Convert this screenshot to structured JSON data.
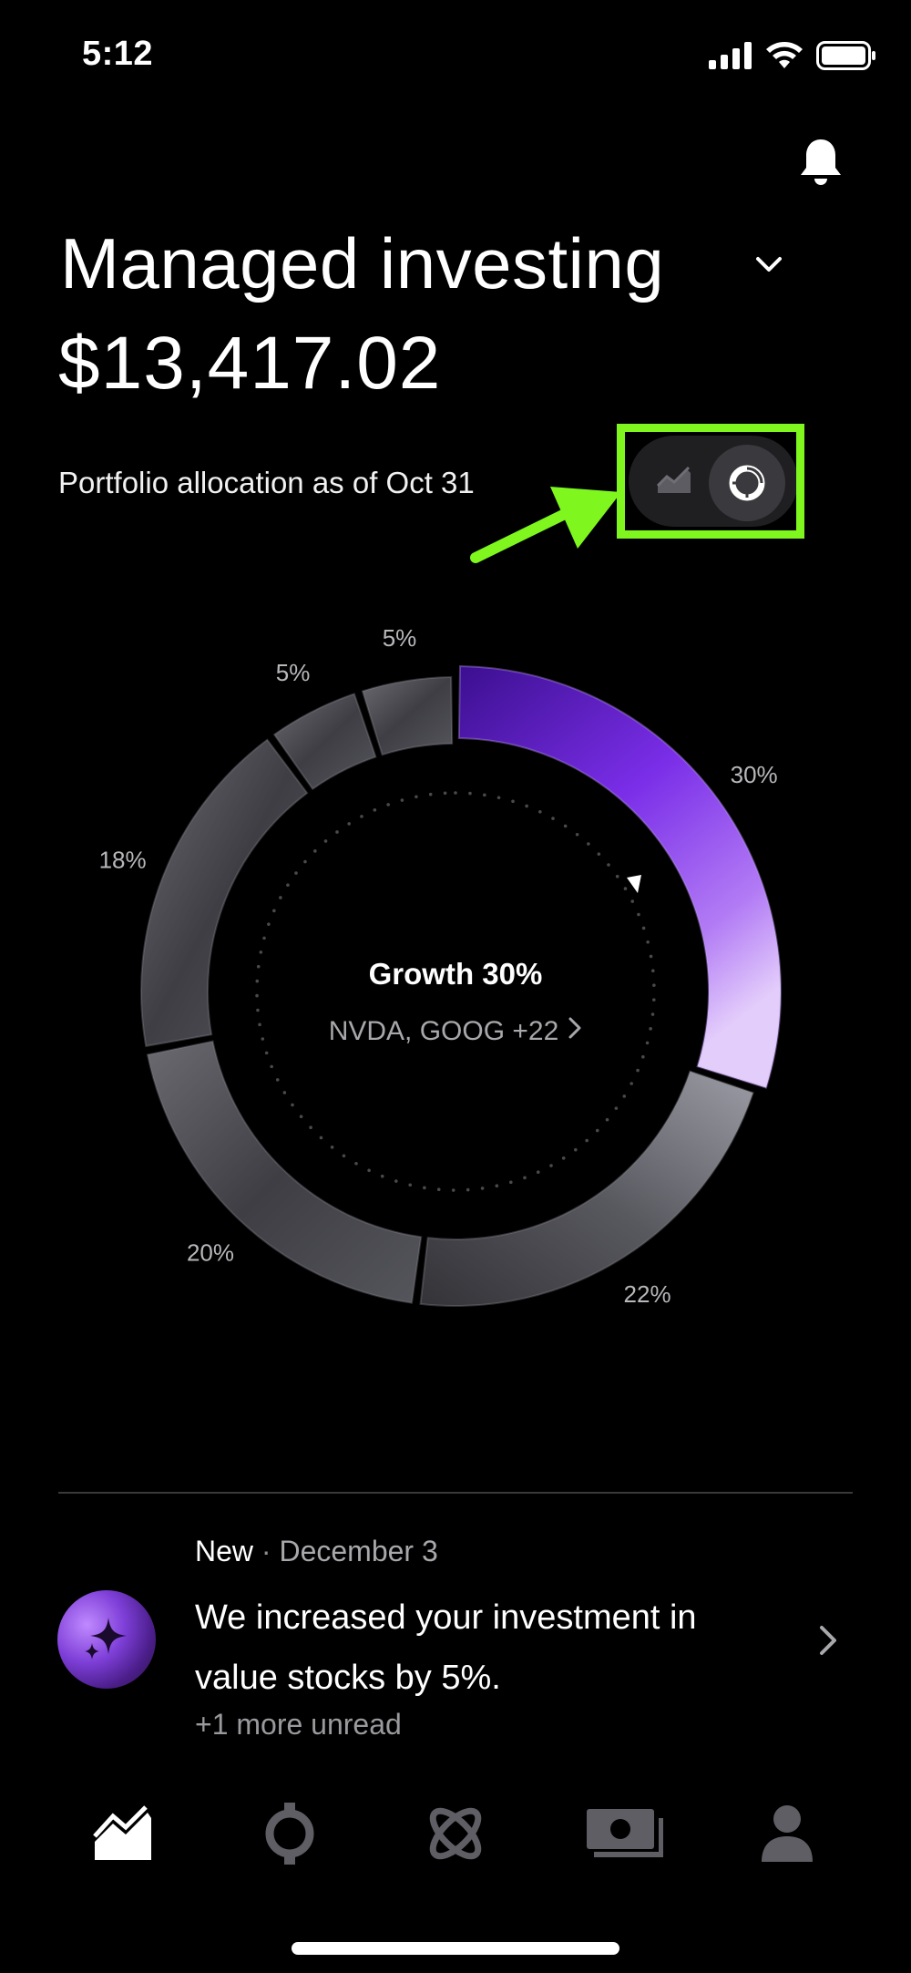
{
  "status_bar": {
    "time": "5:12"
  },
  "header": {
    "title": "Managed investing",
    "balance": "$13,417.02",
    "allocation_label": "Portfolio allocation as of Oct 31"
  },
  "view_toggle": {
    "selected": "pie",
    "highlight_color": "#7ff71f"
  },
  "chart_data": {
    "type": "pie",
    "style": "donut",
    "segments": [
      {
        "value": 30,
        "label": "30%",
        "color": "#8a3df0",
        "selected": true
      },
      {
        "value": 22,
        "label": "22%",
        "color": "#5a5a62"
      },
      {
        "value": 20,
        "label": "20%",
        "color": "#4a4a50"
      },
      {
        "value": 18,
        "label": "18%",
        "color": "#55555b"
      },
      {
        "value": 5,
        "label": "5%",
        "color": "#4e4e54"
      },
      {
        "value": 5,
        "label": "5%",
        "color": "#4e4e54"
      }
    ],
    "center_title": "Growth 30%",
    "center_subtitle": "NVDA, GOOG +22"
  },
  "notification": {
    "badge": "New",
    "separator": "·",
    "date": "December 3",
    "message": "We increased your investment in value stocks by 5%.",
    "more": "+1 more unread"
  },
  "bottom_nav": {
    "items": [
      {
        "icon": "chart-icon",
        "active": true
      },
      {
        "icon": "crypto-icon",
        "active": false
      },
      {
        "icon": "atom-icon",
        "active": false
      },
      {
        "icon": "cash-icon",
        "active": false
      },
      {
        "icon": "account-icon",
        "active": false
      }
    ]
  }
}
